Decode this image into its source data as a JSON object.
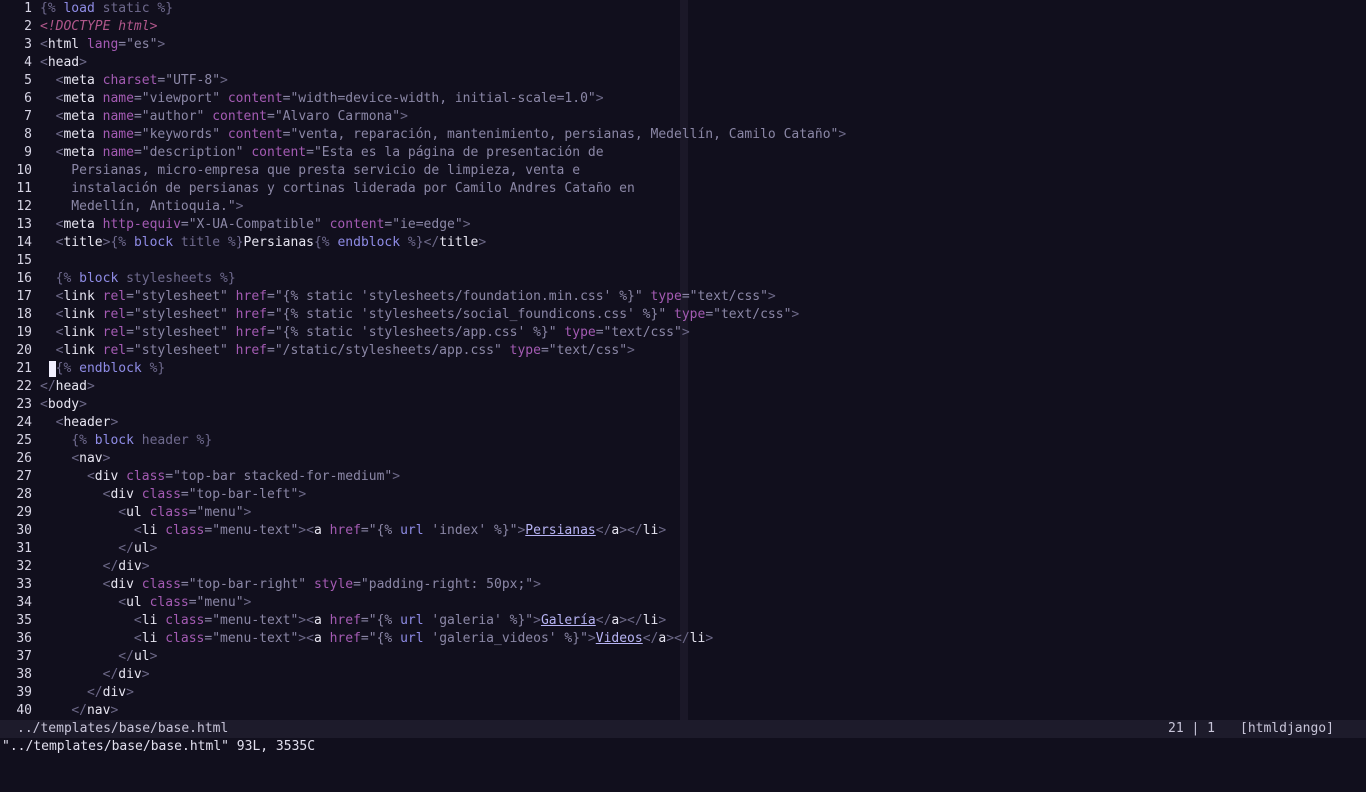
{
  "editor": {
    "line_numbers": [
      "1",
      "2",
      "3",
      "4",
      "5",
      "6",
      "7",
      "8",
      "9",
      "10",
      "11",
      "12",
      "13",
      "14",
      "15",
      "16",
      "17",
      "18",
      "19",
      "20",
      "21",
      "22",
      "23",
      "24",
      "25",
      "26",
      "27",
      "28",
      "29",
      "30",
      "31",
      "32",
      "33",
      "34",
      "35",
      "36",
      "37",
      "38",
      "39",
      "40"
    ],
    "lines": [
      [
        {
          "t": "dj",
          "v": "{% "
        },
        {
          "t": "kw",
          "v": "load"
        },
        {
          "t": "dj",
          "v": " static %}"
        }
      ],
      [
        {
          "t": "doc",
          "v": "<!DOCTYPE html>"
        }
      ],
      [
        {
          "t": "br",
          "v": "<"
        },
        {
          "t": "tag",
          "v": "html"
        },
        {
          "t": "attr",
          "v": " lang"
        },
        {
          "t": "str",
          "v": "=\"es\""
        },
        {
          "t": "br",
          "v": ">"
        }
      ],
      [
        {
          "t": "br",
          "v": "<"
        },
        {
          "t": "tag",
          "v": "head"
        },
        {
          "t": "br",
          "v": ">"
        }
      ],
      [
        {
          "t": "txt",
          "v": "  "
        },
        {
          "t": "br",
          "v": "<"
        },
        {
          "t": "tag",
          "v": "meta"
        },
        {
          "t": "attr",
          "v": " charset"
        },
        {
          "t": "str",
          "v": "=\"UTF-8\""
        },
        {
          "t": "br",
          "v": ">"
        }
      ],
      [
        {
          "t": "txt",
          "v": "  "
        },
        {
          "t": "br",
          "v": "<"
        },
        {
          "t": "tag",
          "v": "meta"
        },
        {
          "t": "attr",
          "v": " name"
        },
        {
          "t": "str",
          "v": "=\"viewport\""
        },
        {
          "t": "attr",
          "v": " content"
        },
        {
          "t": "str",
          "v": "=\"width=device-width, initial-scale=1.0\""
        },
        {
          "t": "br",
          "v": ">"
        }
      ],
      [
        {
          "t": "txt",
          "v": "  "
        },
        {
          "t": "br",
          "v": "<"
        },
        {
          "t": "tag",
          "v": "meta"
        },
        {
          "t": "attr",
          "v": " name"
        },
        {
          "t": "str",
          "v": "=\"author\""
        },
        {
          "t": "attr",
          "v": " content"
        },
        {
          "t": "str",
          "v": "=\"Alvaro Carmona\""
        },
        {
          "t": "br",
          "v": ">"
        }
      ],
      [
        {
          "t": "txt",
          "v": "  "
        },
        {
          "t": "br",
          "v": "<"
        },
        {
          "t": "tag",
          "v": "meta"
        },
        {
          "t": "attr",
          "v": " name"
        },
        {
          "t": "str",
          "v": "=\"keywords\""
        },
        {
          "t": "attr",
          "v": " content"
        },
        {
          "t": "str",
          "v": "=\"venta, reparación, mantenimiento, persianas, Medellín, Camilo Cataño\""
        },
        {
          "t": "br",
          "v": ">"
        }
      ],
      [
        {
          "t": "txt",
          "v": "  "
        },
        {
          "t": "br",
          "v": "<"
        },
        {
          "t": "tag",
          "v": "meta"
        },
        {
          "t": "attr",
          "v": " name"
        },
        {
          "t": "str",
          "v": "=\"description\""
        },
        {
          "t": "attr",
          "v": " content"
        },
        {
          "t": "str",
          "v": "=\"Esta es la página de presentación de"
        }
      ],
      [
        {
          "t": "str",
          "v": "    Persianas, micro-empresa que presta servicio de limpieza, venta e"
        }
      ],
      [
        {
          "t": "str",
          "v": "    instalación de persianas y cortinas liderada por Camilo Andres Cataño en"
        }
      ],
      [
        {
          "t": "str",
          "v": "    Medellín, Antioquia.\""
        },
        {
          "t": "br",
          "v": ">"
        }
      ],
      [
        {
          "t": "txt",
          "v": "  "
        },
        {
          "t": "br",
          "v": "<"
        },
        {
          "t": "tag",
          "v": "meta"
        },
        {
          "t": "attr",
          "v": " http-equiv"
        },
        {
          "t": "str",
          "v": "=\"X-UA-Compatible\""
        },
        {
          "t": "attr",
          "v": " content"
        },
        {
          "t": "str",
          "v": "=\"ie=edge\""
        },
        {
          "t": "br",
          "v": ">"
        }
      ],
      [
        {
          "t": "txt",
          "v": "  "
        },
        {
          "t": "br",
          "v": "<"
        },
        {
          "t": "tag",
          "v": "title"
        },
        {
          "t": "br",
          "v": ">"
        },
        {
          "t": "dj",
          "v": "{% "
        },
        {
          "t": "kw",
          "v": "block"
        },
        {
          "t": "dj",
          "v": " title %}"
        },
        {
          "t": "txt",
          "v": "Persianas"
        },
        {
          "t": "dj",
          "v": "{% "
        },
        {
          "t": "kw",
          "v": "endblock"
        },
        {
          "t": "dj",
          "v": " %}"
        },
        {
          "t": "br",
          "v": "</"
        },
        {
          "t": "tag",
          "v": "title"
        },
        {
          "t": "br",
          "v": ">"
        }
      ],
      [],
      [
        {
          "t": "txt",
          "v": "  "
        },
        {
          "t": "dj",
          "v": "{% "
        },
        {
          "t": "kw",
          "v": "block"
        },
        {
          "t": "dj",
          "v": " stylesheets %}"
        }
      ],
      [
        {
          "t": "txt",
          "v": "  "
        },
        {
          "t": "br",
          "v": "<"
        },
        {
          "t": "tag",
          "v": "link"
        },
        {
          "t": "attr",
          "v": " rel"
        },
        {
          "t": "str",
          "v": "=\"stylesheet\""
        },
        {
          "t": "attr",
          "v": " href"
        },
        {
          "t": "str",
          "v": "=\"{% static 'stylesheets/foundation.min.css' %}\""
        },
        {
          "t": "attr",
          "v": " type"
        },
        {
          "t": "str",
          "v": "=\"text/css\""
        },
        {
          "t": "br",
          "v": ">"
        }
      ],
      [
        {
          "t": "txt",
          "v": "  "
        },
        {
          "t": "br",
          "v": "<"
        },
        {
          "t": "tag",
          "v": "link"
        },
        {
          "t": "attr",
          "v": " rel"
        },
        {
          "t": "str",
          "v": "=\"stylesheet\""
        },
        {
          "t": "attr",
          "v": " href"
        },
        {
          "t": "str",
          "v": "=\"{% static 'stylesheets/social_foundicons.css' %}\""
        },
        {
          "t": "attr",
          "v": " type"
        },
        {
          "t": "str",
          "v": "=\"text/css\""
        },
        {
          "t": "br",
          "v": ">"
        }
      ],
      [
        {
          "t": "txt",
          "v": "  "
        },
        {
          "t": "br",
          "v": "<"
        },
        {
          "t": "tag",
          "v": "link"
        },
        {
          "t": "attr",
          "v": " rel"
        },
        {
          "t": "str",
          "v": "=\"stylesheet\""
        },
        {
          "t": "attr",
          "v": " href"
        },
        {
          "t": "str",
          "v": "=\"{% static 'stylesheets/app.css' %}\""
        },
        {
          "t": "attr",
          "v": " type"
        },
        {
          "t": "str",
          "v": "=\"text/css\""
        },
        {
          "t": "br",
          "v": ">"
        }
      ],
      [
        {
          "t": "txt",
          "v": "  "
        },
        {
          "t": "br",
          "v": "<"
        },
        {
          "t": "tag",
          "v": "link"
        },
        {
          "t": "attr",
          "v": " rel"
        },
        {
          "t": "str",
          "v": "=\"stylesheet\""
        },
        {
          "t": "attr",
          "v": " href"
        },
        {
          "t": "str",
          "v": "=\"/static/stylesheets/app.css\""
        },
        {
          "t": "attr",
          "v": " type"
        },
        {
          "t": "str",
          "v": "=\"text/css\""
        },
        {
          "t": "br",
          "v": ">"
        }
      ],
      [
        {
          "t": "txt",
          "v": "  "
        },
        {
          "t": "dj",
          "v": "{% "
        },
        {
          "t": "kw",
          "v": "endblock"
        },
        {
          "t": "dj",
          "v": " %}"
        }
      ],
      [
        {
          "t": "br",
          "v": "</"
        },
        {
          "t": "tag",
          "v": "head"
        },
        {
          "t": "br",
          "v": ">"
        }
      ],
      [
        {
          "t": "br",
          "v": "<"
        },
        {
          "t": "tag",
          "v": "body"
        },
        {
          "t": "br",
          "v": ">"
        }
      ],
      [
        {
          "t": "txt",
          "v": "  "
        },
        {
          "t": "br",
          "v": "<"
        },
        {
          "t": "tag",
          "v": "header"
        },
        {
          "t": "br",
          "v": ">"
        }
      ],
      [
        {
          "t": "txt",
          "v": "    "
        },
        {
          "t": "dj",
          "v": "{% "
        },
        {
          "t": "kw",
          "v": "block"
        },
        {
          "t": "dj",
          "v": " header %}"
        }
      ],
      [
        {
          "t": "txt",
          "v": "    "
        },
        {
          "t": "br",
          "v": "<"
        },
        {
          "t": "tag",
          "v": "nav"
        },
        {
          "t": "br",
          "v": ">"
        }
      ],
      [
        {
          "t": "txt",
          "v": "      "
        },
        {
          "t": "br",
          "v": "<"
        },
        {
          "t": "tag",
          "v": "div"
        },
        {
          "t": "attr",
          "v": " class"
        },
        {
          "t": "str",
          "v": "=\"top-bar stacked-for-medium\""
        },
        {
          "t": "br",
          "v": ">"
        }
      ],
      [
        {
          "t": "txt",
          "v": "        "
        },
        {
          "t": "br",
          "v": "<"
        },
        {
          "t": "tag",
          "v": "div"
        },
        {
          "t": "attr",
          "v": " class"
        },
        {
          "t": "str",
          "v": "=\"top-bar-left\""
        },
        {
          "t": "br",
          "v": ">"
        }
      ],
      [
        {
          "t": "txt",
          "v": "          "
        },
        {
          "t": "br",
          "v": "<"
        },
        {
          "t": "tag",
          "v": "ul"
        },
        {
          "t": "attr",
          "v": " class"
        },
        {
          "t": "str",
          "v": "=\"menu\""
        },
        {
          "t": "br",
          "v": ">"
        }
      ],
      [
        {
          "t": "txt",
          "v": "            "
        },
        {
          "t": "br",
          "v": "<"
        },
        {
          "t": "tag",
          "v": "li"
        },
        {
          "t": "attr",
          "v": " class"
        },
        {
          "t": "str",
          "v": "=\"menu-text\""
        },
        {
          "t": "br",
          "v": "><"
        },
        {
          "t": "tag",
          "v": "a"
        },
        {
          "t": "attr",
          "v": " href"
        },
        {
          "t": "str",
          "v": "=\"{% "
        },
        {
          "t": "kw",
          "v": "url"
        },
        {
          "t": "str",
          "v": " 'index' %}\""
        },
        {
          "t": "br",
          "v": ">"
        },
        {
          "t": "link",
          "v": "Persianas"
        },
        {
          "t": "br",
          "v": "</"
        },
        {
          "t": "tag",
          "v": "a"
        },
        {
          "t": "br",
          "v": "></"
        },
        {
          "t": "tag",
          "v": "li"
        },
        {
          "t": "br",
          "v": ">"
        }
      ],
      [
        {
          "t": "txt",
          "v": "          "
        },
        {
          "t": "br",
          "v": "</"
        },
        {
          "t": "tag",
          "v": "ul"
        },
        {
          "t": "br",
          "v": ">"
        }
      ],
      [
        {
          "t": "txt",
          "v": "        "
        },
        {
          "t": "br",
          "v": "</"
        },
        {
          "t": "tag",
          "v": "div"
        },
        {
          "t": "br",
          "v": ">"
        }
      ],
      [
        {
          "t": "txt",
          "v": "        "
        },
        {
          "t": "br",
          "v": "<"
        },
        {
          "t": "tag",
          "v": "div"
        },
        {
          "t": "attr",
          "v": " class"
        },
        {
          "t": "str",
          "v": "=\"top-bar-right\""
        },
        {
          "t": "attr",
          "v": " style"
        },
        {
          "t": "str",
          "v": "=\"padding-right: 50px;\""
        },
        {
          "t": "br",
          "v": ">"
        }
      ],
      [
        {
          "t": "txt",
          "v": "          "
        },
        {
          "t": "br",
          "v": "<"
        },
        {
          "t": "tag",
          "v": "ul"
        },
        {
          "t": "attr",
          "v": " class"
        },
        {
          "t": "str",
          "v": "=\"menu\""
        },
        {
          "t": "br",
          "v": ">"
        }
      ],
      [
        {
          "t": "txt",
          "v": "            "
        },
        {
          "t": "br",
          "v": "<"
        },
        {
          "t": "tag",
          "v": "li"
        },
        {
          "t": "attr",
          "v": " class"
        },
        {
          "t": "str",
          "v": "=\"menu-text\""
        },
        {
          "t": "br",
          "v": "><"
        },
        {
          "t": "tag",
          "v": "a"
        },
        {
          "t": "attr",
          "v": " href"
        },
        {
          "t": "str",
          "v": "=\"{% "
        },
        {
          "t": "kw",
          "v": "url"
        },
        {
          "t": "str",
          "v": " 'galeria' %}\""
        },
        {
          "t": "br",
          "v": ">"
        },
        {
          "t": "link",
          "v": "Galería"
        },
        {
          "t": "br",
          "v": "</"
        },
        {
          "t": "tag",
          "v": "a"
        },
        {
          "t": "br",
          "v": "></"
        },
        {
          "t": "tag",
          "v": "li"
        },
        {
          "t": "br",
          "v": ">"
        }
      ],
      [
        {
          "t": "txt",
          "v": "            "
        },
        {
          "t": "br",
          "v": "<"
        },
        {
          "t": "tag",
          "v": "li"
        },
        {
          "t": "attr",
          "v": " class"
        },
        {
          "t": "str",
          "v": "=\"menu-text\""
        },
        {
          "t": "br",
          "v": "><"
        },
        {
          "t": "tag",
          "v": "a"
        },
        {
          "t": "attr",
          "v": " href"
        },
        {
          "t": "str",
          "v": "=\"{% "
        },
        {
          "t": "kw",
          "v": "url"
        },
        {
          "t": "str",
          "v": " 'galeria_videos' %}\""
        },
        {
          "t": "br",
          "v": ">"
        },
        {
          "t": "link",
          "v": "Videos"
        },
        {
          "t": "br",
          "v": "</"
        },
        {
          "t": "tag",
          "v": "a"
        },
        {
          "t": "br",
          "v": "></"
        },
        {
          "t": "tag",
          "v": "li"
        },
        {
          "t": "br",
          "v": ">"
        }
      ],
      [
        {
          "t": "txt",
          "v": "          "
        },
        {
          "t": "br",
          "v": "</"
        },
        {
          "t": "tag",
          "v": "ul"
        },
        {
          "t": "br",
          "v": ">"
        }
      ],
      [
        {
          "t": "txt",
          "v": "        "
        },
        {
          "t": "br",
          "v": "</"
        },
        {
          "t": "tag",
          "v": "div"
        },
        {
          "t": "br",
          "v": ">"
        }
      ],
      [
        {
          "t": "txt",
          "v": "      "
        },
        {
          "t": "br",
          "v": "</"
        },
        {
          "t": "tag",
          "v": "div"
        },
        {
          "t": "br",
          "v": ">"
        }
      ],
      [
        {
          "t": "txt",
          "v": "    "
        },
        {
          "t": "br",
          "v": "</"
        },
        {
          "t": "tag",
          "v": "nav"
        },
        {
          "t": "br",
          "v": ">"
        }
      ]
    ],
    "cursor_line": "21",
    "colors": {
      "background": "#110f1d",
      "tag": "#e7e5f1",
      "attribute": "#a45bb3",
      "string": "#8b87a6",
      "keyword": "#8f8ce6",
      "doctype": "#b0578b",
      "link": "#b8b4f4",
      "statusline_bg": "#1d1b2b"
    }
  },
  "statusline": {
    "file": "../templates/base/base.html",
    "position": "21 | 1",
    "filetype": "[htmldjango]"
  },
  "cmdline": {
    "message": "\"../templates/base/base.html\" 93L, 3535C"
  }
}
